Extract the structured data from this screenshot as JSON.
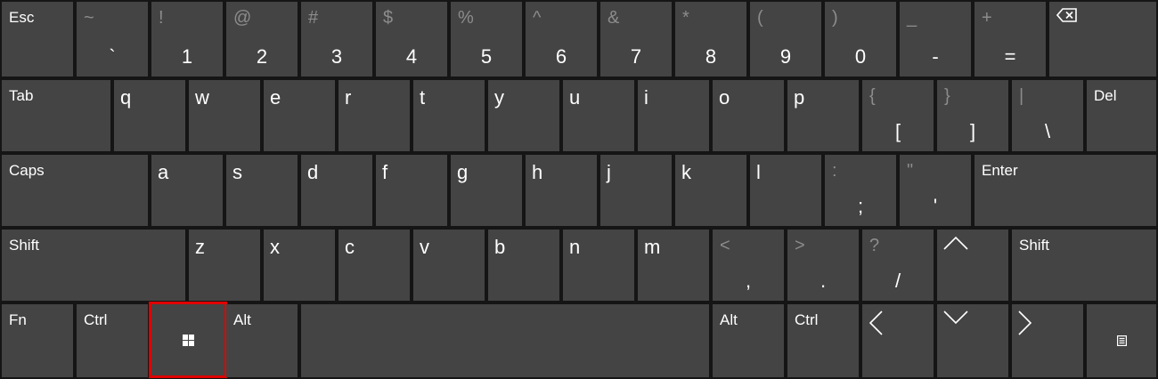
{
  "keyboard": {
    "row1": [
      {
        "label": "Esc"
      },
      {
        "shift": "~",
        "main": "`"
      },
      {
        "shift": "!",
        "main": "1"
      },
      {
        "shift": "@",
        "main": "2"
      },
      {
        "shift": "#",
        "main": "3"
      },
      {
        "shift": "$",
        "main": "4"
      },
      {
        "shift": "%",
        "main": "5"
      },
      {
        "shift": "^",
        "main": "6"
      },
      {
        "shift": "&",
        "main": "7"
      },
      {
        "shift": "*",
        "main": "8"
      },
      {
        "shift": "(",
        "main": "9"
      },
      {
        "shift": ")",
        "main": "0"
      },
      {
        "shift": "_",
        "main": "-"
      },
      {
        "shift": "+",
        "main": "="
      },
      {
        "icon": "backspace-icon"
      }
    ],
    "row2": [
      {
        "label": "Tab"
      },
      {
        "main": "q"
      },
      {
        "main": "w"
      },
      {
        "main": "e"
      },
      {
        "main": "r"
      },
      {
        "main": "t"
      },
      {
        "main": "y"
      },
      {
        "main": "u"
      },
      {
        "main": "i"
      },
      {
        "main": "o"
      },
      {
        "main": "p"
      },
      {
        "shift": "{",
        "main": "["
      },
      {
        "shift": "}",
        "main": "]"
      },
      {
        "shift": "|",
        "main": "\\"
      },
      {
        "label": "Del"
      }
    ],
    "row3": [
      {
        "label": "Caps"
      },
      {
        "main": "a"
      },
      {
        "main": "s"
      },
      {
        "main": "d"
      },
      {
        "main": "f"
      },
      {
        "main": "g"
      },
      {
        "main": "h"
      },
      {
        "main": "j"
      },
      {
        "main": "k"
      },
      {
        "main": "l"
      },
      {
        "shift": ":",
        "main": ";"
      },
      {
        "shift": "\"",
        "main": "'"
      },
      {
        "label": "Enter"
      }
    ],
    "row4": [
      {
        "label": "Shift"
      },
      {
        "main": "z"
      },
      {
        "main": "x"
      },
      {
        "main": "c"
      },
      {
        "main": "v"
      },
      {
        "main": "b"
      },
      {
        "main": "n"
      },
      {
        "main": "m"
      },
      {
        "shift": "<",
        "main": ","
      },
      {
        "shift": ">",
        "main": "."
      },
      {
        "shift": "?",
        "main": "/"
      },
      {
        "icon": "arrow-up-icon"
      },
      {
        "label": "Shift"
      }
    ],
    "row5": [
      {
        "label": "Fn"
      },
      {
        "label": "Ctrl"
      },
      {
        "icon": "windows-logo-icon",
        "highlighted": true
      },
      {
        "label": "Alt"
      },
      {
        "label": ""
      },
      {
        "label": "Alt"
      },
      {
        "label": "Ctrl"
      },
      {
        "icon": "arrow-left-icon"
      },
      {
        "icon": "arrow-down-icon"
      },
      {
        "icon": "arrow-right-icon"
      },
      {
        "icon": "menu-icon"
      }
    ]
  },
  "colors": {
    "background": "#151515",
    "key": "#444444",
    "text": "#ffffff",
    "shift_text": "#8c8c8c",
    "highlight": "#e00000"
  }
}
